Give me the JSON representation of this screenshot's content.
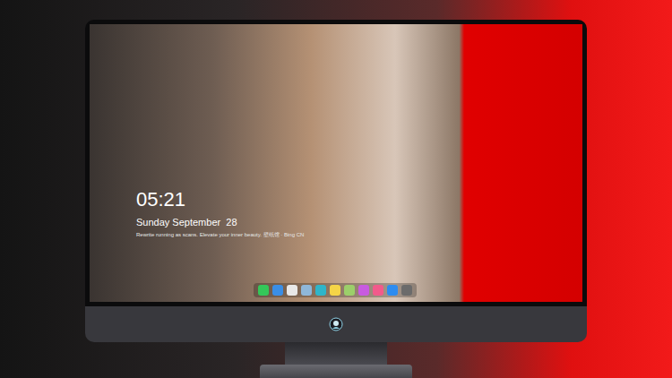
{
  "desktop": {
    "clock": "05:21",
    "date": "Sunday September  28",
    "caption": "Rewrite running as scans. Elevate your inner beauty. 壁纸馆 · Bing CN"
  },
  "dock": [
    {
      "color": "#34c759"
    },
    {
      "color": "#3a8ee6"
    },
    {
      "color": "#e8e8e8"
    },
    {
      "color": "#8fb7d9"
    },
    {
      "color": "#2fb5c9"
    },
    {
      "color": "#f5d547"
    },
    {
      "color": "#9ccf6a"
    },
    {
      "color": "#c85be0"
    },
    {
      "color": "#f25a8b"
    },
    {
      "color": "#2d8cf0"
    },
    {
      "color": "#6b6b6b"
    }
  ]
}
